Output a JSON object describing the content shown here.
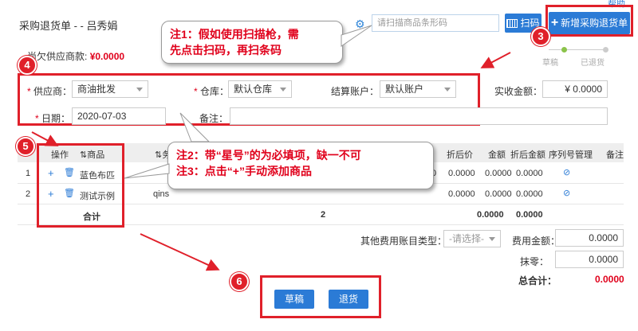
{
  "help_link": "帮助",
  "header": {
    "title": "采购退货单 - - 吕秀娟",
    "search_placeholder": "请扫描商品条形码",
    "scan_button": "扫码",
    "new_button": "新增采购退货单"
  },
  "owe": {
    "label": "尚欠供应商款:",
    "value": "¥0.0000"
  },
  "status_steps": [
    "草稿",
    "已退货"
  ],
  "form": {
    "supplier_label": "供应商：",
    "supplier_value": "商油批发",
    "warehouse_label": "仓库：",
    "warehouse_value": "默认仓库",
    "account_label": "结算账户：",
    "account_value": "默认账户",
    "received_label": "实收金额：",
    "received_value": "¥ 0.0000",
    "date_label": "日期：",
    "date_value": "2020-07-03",
    "remark_label": "备注："
  },
  "table": {
    "headers": [
      "操作",
      "⇅商品",
      "⇅务",
      "折后价",
      "金额",
      "折后金额",
      "序列号管理",
      "备注"
    ],
    "rows": [
      {
        "no": "1",
        "product": "蓝色布匹",
        "extra": "",
        "discount_price": "0.0000",
        "amount": "0.0000",
        "discount_amount": "0.0000"
      },
      {
        "no": "2",
        "product": "测试示例",
        "extra": "qins",
        "discount_price": "0.0000",
        "amount": "0.0000",
        "discount_amount": "0.0000"
      }
    ],
    "total_label": "合计",
    "total_qty": "2",
    "total_amount": "0.0000",
    "total_discount_amount": "0.0000",
    "partial_cell": "0"
  },
  "other_fee": {
    "label": "其他费用账目类型：",
    "placeholder": "-请选择-"
  },
  "fee_amount": {
    "label": "费用金额：",
    "value": "0.0000"
  },
  "rounding": {
    "label": "抹零：",
    "value": "0.0000"
  },
  "grand_total": {
    "label": "总合计：",
    "value": "0.0000"
  },
  "buttons": {
    "draft": "草稿",
    "return": "退货"
  },
  "callouts": {
    "note1_line1": "注1：假如使用扫描枪，需",
    "note1_line2": "先点击扫码，再扫条码",
    "note2": "注2：带“星号”的为必填项，缺一不可",
    "note3": "注3：点击“+”手动添加商品"
  },
  "badges": [
    "3",
    "4",
    "5",
    "6"
  ],
  "colors": {
    "accent": "#2b7bd6",
    "annotation_red": "#e0202a",
    "money_red": "#e0001b"
  }
}
